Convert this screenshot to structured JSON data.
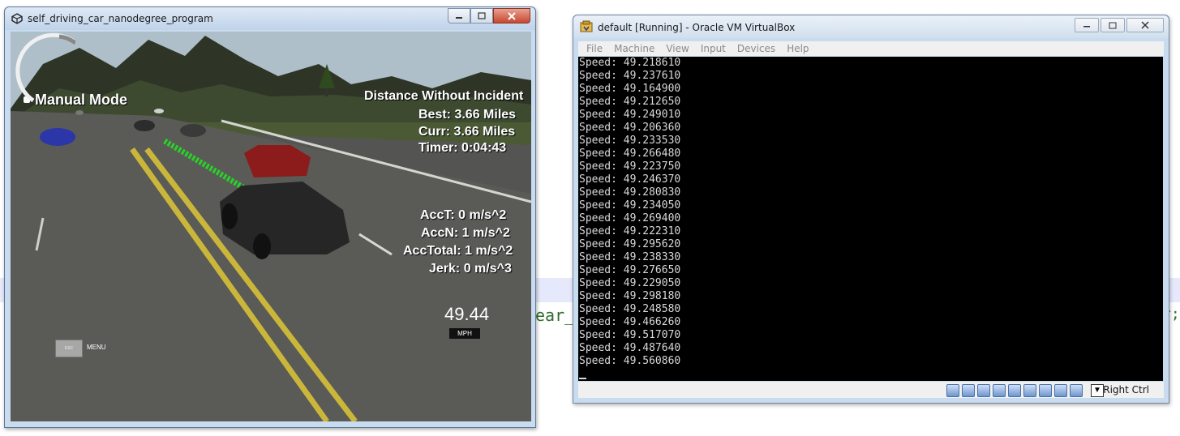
{
  "background": {
    "code_fragment_mid": "ear_",
    "code_fragment_right": "r;"
  },
  "sim": {
    "title": "self_driving_car_nanodegree_program",
    "mode_label": "Manual Mode",
    "distance_title": "Distance Without Incident",
    "best": "Best: 3.66 Miles",
    "curr": "Curr: 3.66 Miles",
    "timer": "Timer: 0:04:43",
    "acct": "AccT: 0 m/s^2",
    "accn": "AccN: 1 m/s^2",
    "acctotal": "AccTotal: 1 m/s^2",
    "jerk": "Jerk: 0 m/s^3",
    "speed_value": "49.44",
    "speed_unit": "MPH",
    "esc_label": "ESC",
    "menu_label": "MENU"
  },
  "vbox": {
    "title": "default [Running] - Oracle VM VirtualBox",
    "menu": [
      "File",
      "Machine",
      "View",
      "Input",
      "Devices",
      "Help"
    ],
    "console_lines": [
      "Speed: 49.218610",
      "Speed: 49.237610",
      "Speed: 49.164900",
      "Speed: 49.212650",
      "Speed: 49.249010",
      "Speed: 49.206360",
      "Speed: 49.233530",
      "Speed: 49.266480",
      "Speed: 49.223750",
      "Speed: 49.246370",
      "Speed: 49.280830",
      "Speed: 49.234050",
      "Speed: 49.269400",
      "Speed: 49.222310",
      "Speed: 49.295620",
      "Speed: 49.238330",
      "Speed: 49.276650",
      "Speed: 49.229050",
      "Speed: 49.298180",
      "Speed: 49.248580",
      "Speed: 49.466260",
      "Speed: 49.517070",
      "Speed: 49.487640",
      "Speed: 49.560860"
    ],
    "host_key": "Right Ctrl"
  }
}
